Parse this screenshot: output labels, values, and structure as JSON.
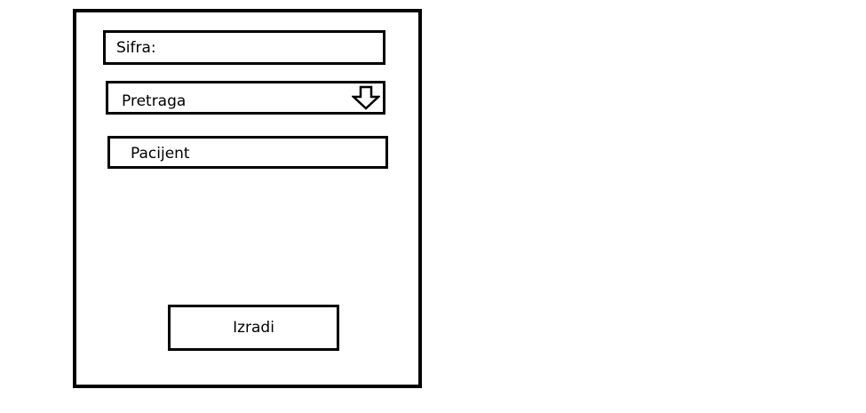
{
  "form": {
    "sifra_label": "Sifra:",
    "pretraga_label": "Pretraga",
    "pretraga_icon": "arrow-down-icon",
    "pacijent_label": "Pacijent",
    "izradi_label": "Izradi"
  }
}
